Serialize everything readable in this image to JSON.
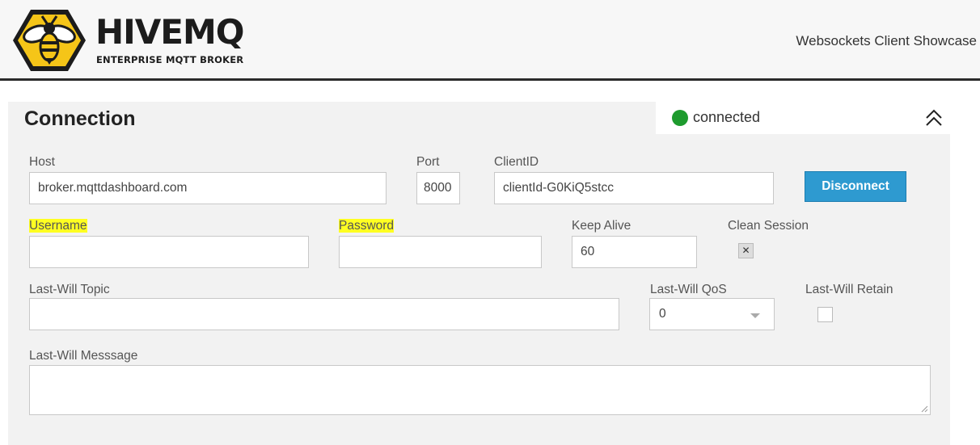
{
  "header": {
    "brand_name": "HIVEMQ",
    "brand_tagline": "ENTERPRISE MQTT BROKER",
    "title": "Websockets Client Showcase",
    "logo_icon": "bee-icon",
    "logo_colors": {
      "yellow": "#f5c518",
      "dark": "#1c1c1c"
    }
  },
  "connection": {
    "title": "Connection",
    "status": {
      "text": "connected",
      "color": "#1e9b2e"
    },
    "collapse_icon": "double-chevron-up-icon",
    "host": {
      "label": "Host",
      "value": "broker.mqttdashboard.com"
    },
    "port": {
      "label": "Port",
      "value": "8000"
    },
    "client_id": {
      "label": "ClientID",
      "value": "clientId-G0KiQ5stcc"
    },
    "disconnect_label": "Disconnect",
    "username": {
      "label": "Username",
      "value": ""
    },
    "password": {
      "label": "Password",
      "value": ""
    },
    "keep_alive": {
      "label": "Keep Alive",
      "value": "60"
    },
    "clean_session": {
      "label": "Clean Session",
      "checked": true,
      "mark": "✕"
    },
    "last_will_topic": {
      "label": "Last-Will Topic",
      "value": ""
    },
    "last_will_qos": {
      "label": "Last-Will QoS",
      "value": "0"
    },
    "last_will_retain": {
      "label": "Last-Will Retain",
      "checked": false
    },
    "last_will_message": {
      "label": "Last-Will Messsage",
      "value": ""
    }
  },
  "colors": {
    "accent_button": "#2e9ad0",
    "label_highlight": "#ffff22",
    "panel_background": "#f2f2f2"
  }
}
